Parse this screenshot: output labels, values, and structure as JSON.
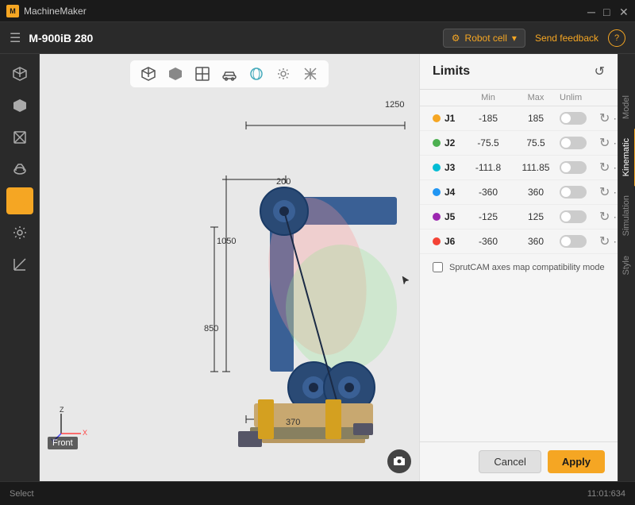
{
  "app": {
    "title": "MachineMaker",
    "machine": "M-900iB 280"
  },
  "header": {
    "hamburger": "☰",
    "robot_cell_label": "Robot cell",
    "send_feedback": "Send feedback",
    "help": "?"
  },
  "viewport": {
    "tools": [
      "cube-3d",
      "cube-solid",
      "cube-wireframe",
      "car-icon",
      "sphere-icon",
      "gear-icon",
      "axes-icon"
    ],
    "dimensions": {
      "d1250": "1250",
      "d200": "200",
      "d1050": "1050",
      "d850": "850",
      "d370": "370"
    },
    "view_label": "Front",
    "camera_icon": "📷"
  },
  "side_tabs": [
    {
      "label": "Model",
      "active": false
    },
    {
      "label": "Kinematic",
      "active": true
    },
    {
      "label": "Simulation",
      "active": false
    },
    {
      "label": "Style",
      "active": false
    }
  ],
  "limits": {
    "title": "Limits",
    "reset_icon": "↺",
    "columns": {
      "joint": "",
      "min": "Min",
      "max": "Max",
      "unlim": "Unlim"
    },
    "joints": [
      {
        "name": "J1",
        "color": "#f5a623",
        "min": "-185",
        "max": "185"
      },
      {
        "name": "J2",
        "color": "#4caf50",
        "min": "-75.5",
        "max": "75.5"
      },
      {
        "name": "J3",
        "color": "#00bcd4",
        "min": "-111.8",
        "max": "111.85"
      },
      {
        "name": "J4",
        "color": "#2196f3",
        "min": "-360",
        "max": "360"
      },
      {
        "name": "J5",
        "color": "#9c27b0",
        "min": "-125",
        "max": "125"
      },
      {
        "name": "J6",
        "color": "#f44336",
        "min": "-360",
        "max": "360"
      }
    ],
    "sprut_compat_label": "SprutCAM axes map compatibility mode"
  },
  "buttons": {
    "cancel": "Cancel",
    "apply": "Apply"
  },
  "status": {
    "text": "Select",
    "time": "11:01:634"
  }
}
